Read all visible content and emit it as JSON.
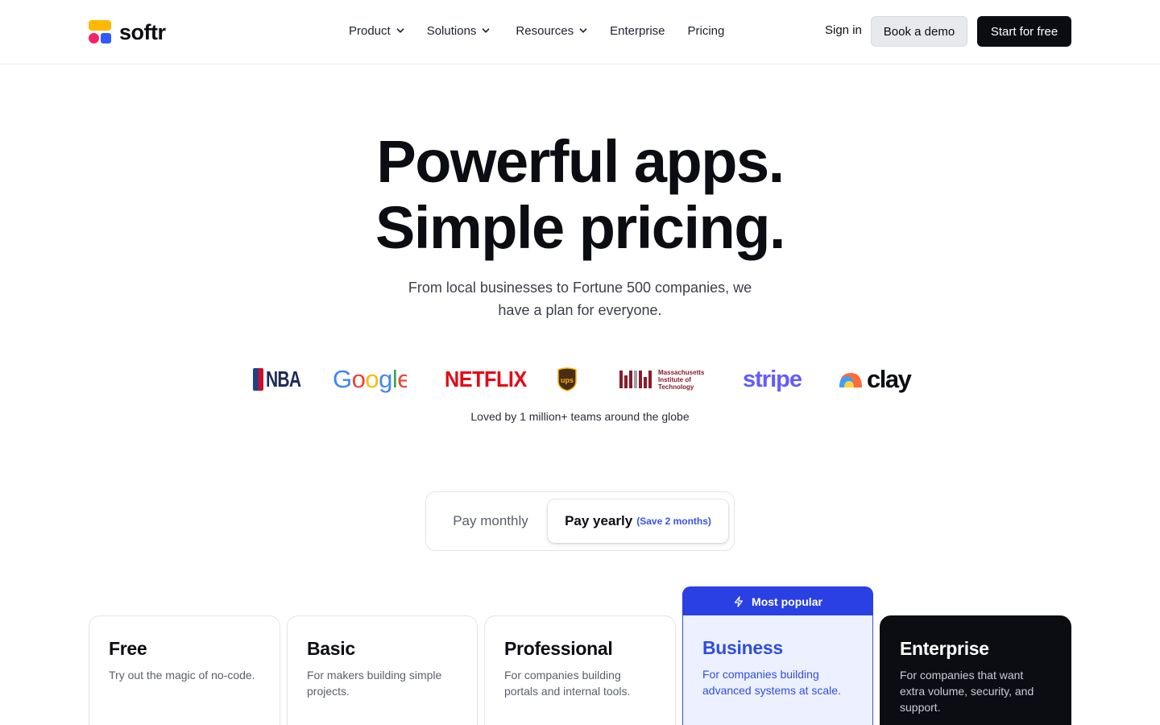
{
  "brand": {
    "name": "softr"
  },
  "nav": {
    "menu": [
      {
        "label": "Product",
        "has_dropdown": true
      },
      {
        "label": "Solutions",
        "has_dropdown": true
      },
      {
        "label": "Resources",
        "has_dropdown": true
      },
      {
        "label": "Enterprise",
        "has_dropdown": false
      },
      {
        "label": "Pricing",
        "has_dropdown": false
      }
    ],
    "sign_in": "Sign in",
    "book_demo": "Book a demo",
    "start_free": "Start for free"
  },
  "hero": {
    "title_line1": "Powerful apps.",
    "title_line2": "Simple pricing.",
    "subtitle": "From local businesses to Fortune 500 companies, we have a plan for everyone."
  },
  "logos": {
    "items": [
      "NBA",
      "Google",
      "NETFLIX",
      "ups",
      "Massachusetts Institute of Technology",
      "stripe",
      "clay"
    ],
    "mit_lines": [
      "Massachusetts",
      "Institute of",
      "Technology"
    ],
    "caption": "Loved by 1 million+ teams around the globe"
  },
  "billing": {
    "monthly": "Pay monthly",
    "yearly": "Pay yearly",
    "save_note": "(Save 2 months)",
    "selected": "yearly"
  },
  "plans": [
    {
      "name": "Free",
      "description": "Try out the magic of no-code."
    },
    {
      "name": "Basic",
      "description": "For makers building simple projects."
    },
    {
      "name": "Professional",
      "description": "For companies building portals and internal tools."
    },
    {
      "name": "Business",
      "description": "For companies building advanced systems at scale.",
      "badge": "Most popular"
    },
    {
      "name": "Enterprise",
      "description": "For companies that want extra volume, security, and support."
    }
  ],
  "colors": {
    "accent": "#2b40e3",
    "dark": "#0b0d12",
    "logo_yellow": "#ffb800",
    "logo_pink": "#f5206e",
    "logo_blue": "#2f5bff"
  }
}
